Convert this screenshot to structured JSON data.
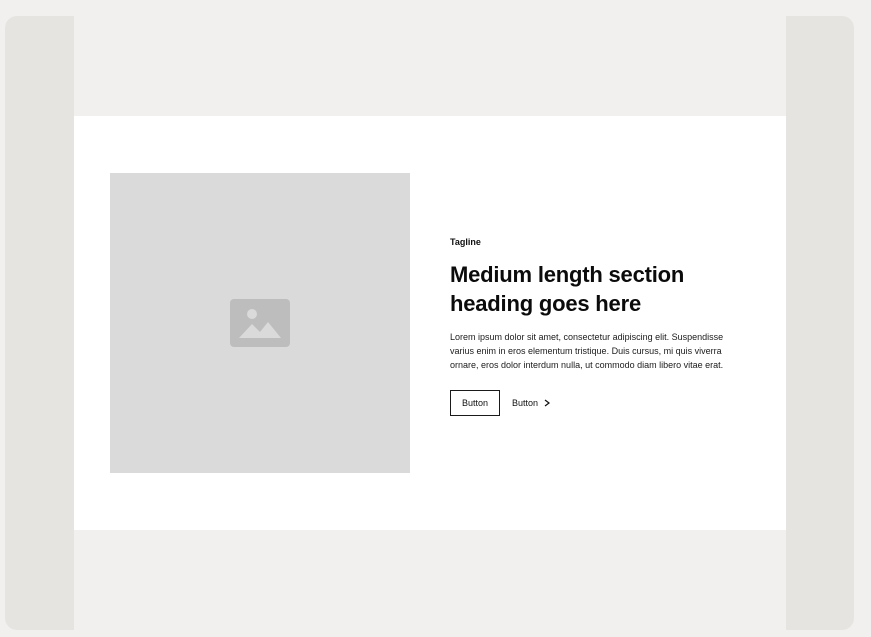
{
  "section": {
    "tagline": "Tagline",
    "heading": "Medium length section heading goes here",
    "body": "Lorem ipsum dolor sit amet, consectetur adipiscing elit. Suspendisse varius enim in eros elementum tristique. Duis cursus, mi quis viverra ornare, eros dolor interdum nulla, ut commodo diam libero vitae erat.",
    "primary_button_label": "Button",
    "secondary_button_label": "Button",
    "media_icon": "image-placeholder-icon",
    "secondary_button_icon": "chevron-right-icon"
  },
  "colors": {
    "page_background": "#f1f0ee",
    "frame_background": "#e5e4e0",
    "section_background": "#ffffff",
    "media_placeholder": "#dadada",
    "media_icon": "#bdbdbd",
    "text": "#111111"
  }
}
